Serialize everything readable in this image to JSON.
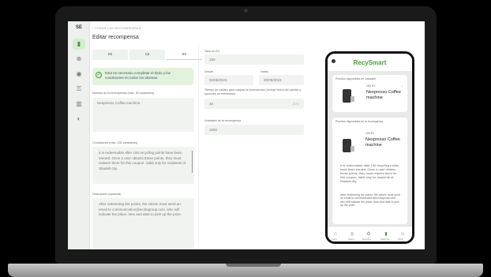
{
  "sidebar": {
    "logo": "SE",
    "items": [
      {
        "name": "gift-icon",
        "glyph": "▮",
        "active": true
      },
      {
        "name": "globe-icon",
        "glyph": "⊕"
      },
      {
        "name": "chat-icon",
        "glyph": "◉"
      },
      {
        "name": "key-icon",
        "glyph": "⚿"
      },
      {
        "name": "report-icon",
        "glyph": "▥"
      },
      {
        "name": "theme-icon",
        "glyph": "◐"
      }
    ]
  },
  "breadcrumb": "‹ TODAS LAS RECOMPENSAS",
  "page": {
    "title": "Editar recompensa"
  },
  "lang_tabs": [
    "es",
    "ca",
    "en"
  ],
  "alert": {
    "icon": "✓",
    "text": "Esta es necesario completar el título y las condiciones en todos los idiomas."
  },
  "form": {
    "name_label": "Nombre de la recompensa (máx. 50 caracteres)",
    "name_value": "Nespresso Coffee machine",
    "conditions_label": "Condiciones (máx. 300 caracteres)",
    "conditions_text": "It is redeemable after 150 recycling points have been earned. Once a user obtains these points, they must redeem them for this coupon. Valid only for residents of Sbadell city.",
    "description_label": "Descripción (opcional)",
    "description_text": "After redeeming the points, the citizen must send an email to communication@ecologroup.com, who will indicate the place, time and date to pick up the prize.",
    "points_label": "Valor en EV",
    "points_value": "150",
    "start_label": "Desde",
    "start_value": "02/05/2023",
    "end_label": "Hasta",
    "end_value": "30/05/2023",
    "validity_label": "Tiempo de validez para canjear la recompensa (Incluye fecha del cambio y opciones de reembolso)",
    "validity_value": "30",
    "validity_unit": "días",
    "stock_label": "Unidades de la recompensa",
    "stock_value": "1000"
  },
  "phone": {
    "brand": "RecySmart",
    "section1_title": "Premios disponibles en Sabadell",
    "card1_points": "150 EV",
    "card1_name": "Nespresso Coffee machine",
    "section2_title": "Premios disponibles en la recompensa",
    "card2_points": "150 EV",
    "card2_name": "Nespresso Coffee machine",
    "card2_text": "It is redeemable after 150 recycling points have been earned. Once a user obtains these points, they must redeem them for this coupon. Valid only for residents of Sbadell city.",
    "card2_text2": "After redeeming the points, the citizen must send an email to communication@ecologroup.com, who will indicate the place, time and date to pick up the prize.",
    "nav": [
      {
        "label": "Inicio",
        "glyph": "⌂"
      },
      {
        "label": "Mapa",
        "glyph": "◎"
      },
      {
        "label": "Reciclar",
        "glyph": "♻"
      },
      {
        "label": "Premios",
        "glyph": "▮",
        "active": true
      },
      {
        "label": "Perfil",
        "glyph": "☺"
      }
    ]
  }
}
